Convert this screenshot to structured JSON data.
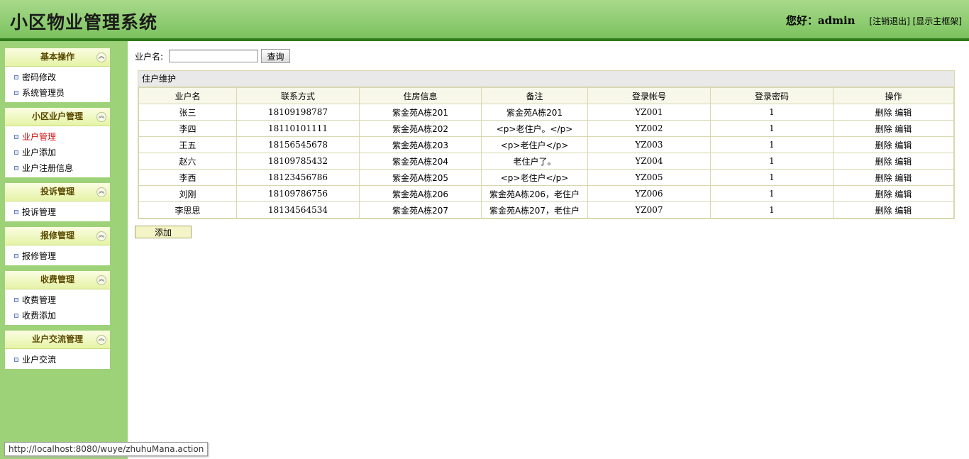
{
  "header": {
    "title": "小区物业管理系统",
    "greeting": "您好：admin",
    "logout_link": "[注销退出]",
    "show_frame_link": "[显示主框架]"
  },
  "sidebar": {
    "toggle_glyph": "«",
    "panels": [
      {
        "title": "基本操作",
        "items": [
          "密码修改",
          "系统管理员"
        ]
      },
      {
        "title": "小区业户管理",
        "items": [
          "业户管理",
          "业户添加",
          "业户注册信息"
        ],
        "active_item": "业户管理"
      },
      {
        "title": "投诉管理",
        "items": [
          "投诉管理"
        ]
      },
      {
        "title": "报修管理",
        "items": [
          "报修管理"
        ]
      },
      {
        "title": "收费管理",
        "items": [
          "收费管理",
          "收费添加"
        ]
      },
      {
        "title": "业户交流管理",
        "items": [
          "业户交流"
        ]
      }
    ]
  },
  "search": {
    "label": "业户名:",
    "value": "",
    "button": "查询"
  },
  "table": {
    "caption": "住户维护",
    "headers": [
      "业户名",
      "联系方式",
      "住房信息",
      "备注",
      "登录帐号",
      "登录密码",
      "操作"
    ],
    "delete_label": "删除",
    "edit_label": "编辑",
    "rows": [
      [
        "张三",
        "18109198787",
        "紫金苑A栋201",
        "紫金苑A栋201",
        "YZ001",
        "1"
      ],
      [
        "李四",
        "18110101111",
        "紫金苑A栋202",
        "<p>老住户。</p>",
        "YZ002",
        "1"
      ],
      [
        "王五",
        "18156545678",
        "紫金苑A栋203",
        "<p>老住户</p>",
        "YZ003",
        "1"
      ],
      [
        "赵六",
        "18109785432",
        "紫金苑A栋204",
        "老住户了。",
        "YZ004",
        "1"
      ],
      [
        "李西",
        "18123456786",
        "紫金苑A栋205",
        "<p>老住户</p>",
        "YZ005",
        "1"
      ],
      [
        "刘刚",
        "18109786756",
        "紫金苑A栋206",
        "紫金苑A栋206，老住户",
        "YZ006",
        "1"
      ],
      [
        "李思思",
        "18134564534",
        "紫金苑A栋207",
        "紫金苑A栋207，老住户",
        "YZ007",
        "1"
      ]
    ]
  },
  "add_button": "添加",
  "status_url": "http://localhost:8080/wuye/zhuhuMana.action"
}
